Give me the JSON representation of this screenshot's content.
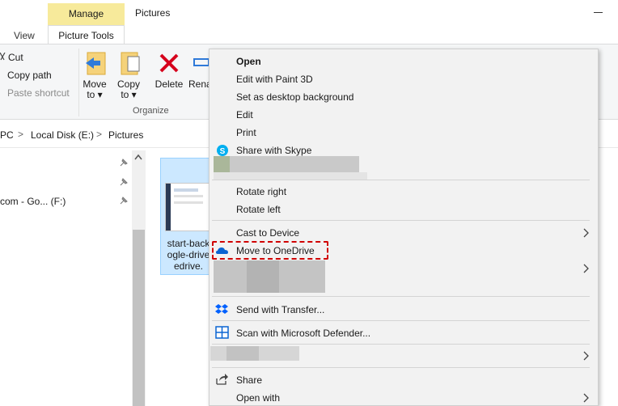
{
  "window": {
    "title": "Pictures",
    "contextual_tab_group": "Manage",
    "tabs": [
      "View",
      "Picture Tools"
    ]
  },
  "ribbon": {
    "small_buttons": {
      "cut": "Cut",
      "copy_path": "Copy path",
      "paste_shortcut": "Paste shortcut"
    },
    "big_buttons": {
      "move_to": [
        "Move",
        "to ▾"
      ],
      "copy_to": [
        "Copy",
        "to ▾"
      ],
      "delete": "Delete",
      "rename": "Rena"
    },
    "group_label": "Organize"
  },
  "address": {
    "crumbs": [
      "PC",
      "Local Disk (E:)",
      "Pictures"
    ],
    "separator": ">"
  },
  "nav": {
    "drive_label": "com - Go... (F:)"
  },
  "file": {
    "name_lines": [
      "start-back",
      "ogle-drive",
      "edrive."
    ]
  },
  "context_menu": {
    "items": {
      "open": "Open",
      "edit_paint3d": "Edit with Paint 3D",
      "set_desktop_bg": "Set as desktop background",
      "edit": "Edit",
      "print": "Print",
      "share_skype": "Share with Skype",
      "rotate_right": "Rotate right",
      "rotate_left": "Rotate left",
      "cast": "Cast to Device",
      "move_onedrive": "Move to OneDrive",
      "send_transfer": "Send with Transfer...",
      "scan_defender": "Scan with Microsoft Defender...",
      "share": "Share",
      "open_with": "Open with"
    },
    "highlight_color": "#d00000"
  },
  "colors": {
    "manage_tab": "#f7ea9b",
    "selection": "#cce8ff",
    "menu_bg": "#f2f2f2"
  }
}
